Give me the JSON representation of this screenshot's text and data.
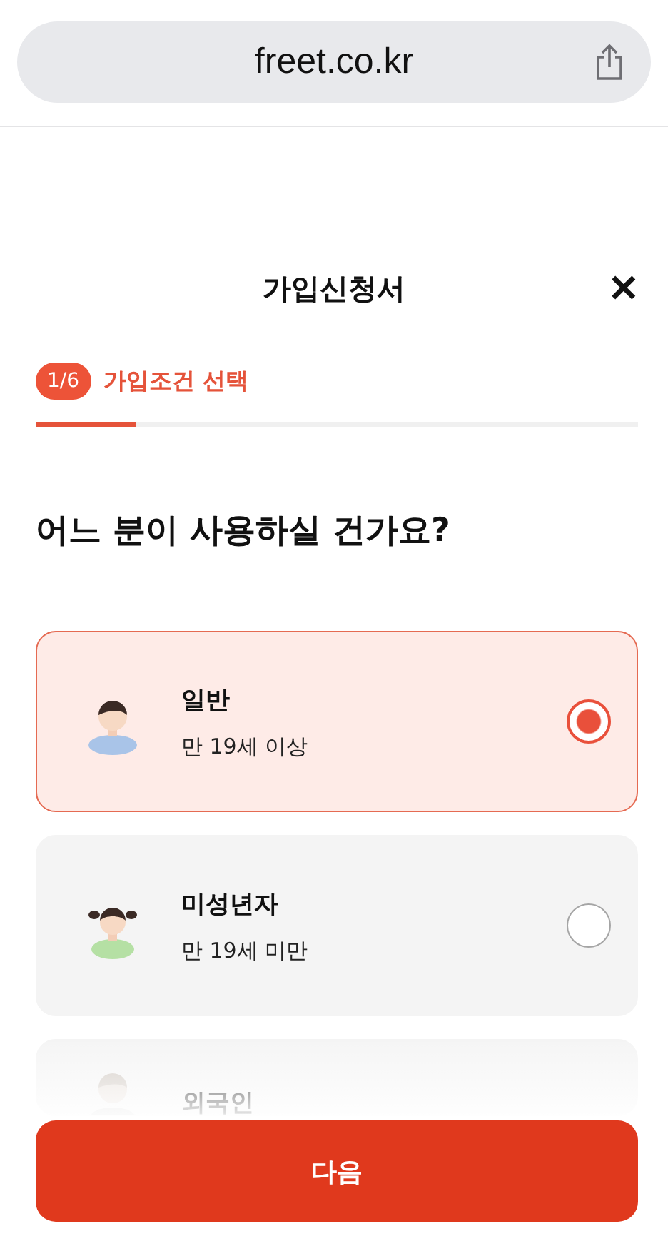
{
  "browser": {
    "url": "freet.co.kr"
  },
  "header": {
    "title": "가입신청서",
    "close": "✕"
  },
  "step": {
    "badge": "1/6",
    "label": "가입조건 선택",
    "level": 0.167
  },
  "question": "어느 분이 사용하실 건가요?",
  "options": [
    {
      "kind": "boy",
      "title": "일반",
      "subtitle": "만 19세 이상",
      "selected": true
    },
    {
      "kind": "girl",
      "title": "미성년자",
      "subtitle": "만 19세 미만",
      "selected": false
    },
    {
      "kind": "adult",
      "title": "외국인",
      "selected": false
    }
  ],
  "next_button": "다음"
}
